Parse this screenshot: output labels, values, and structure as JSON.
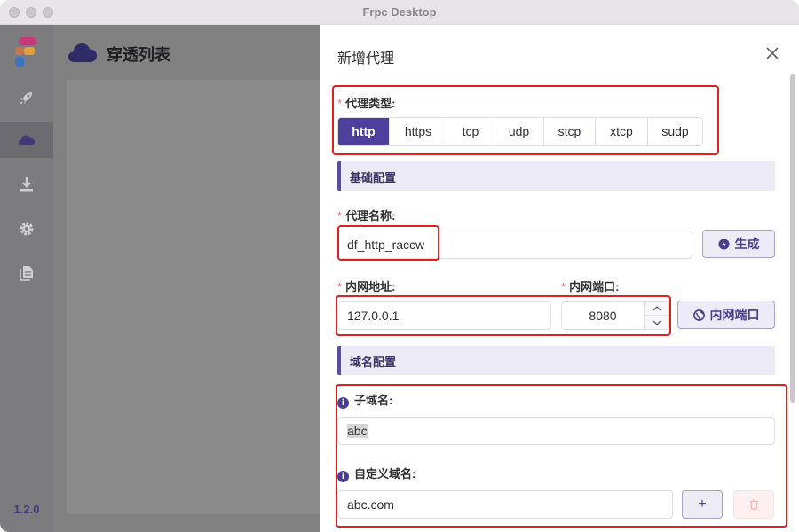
{
  "window": {
    "title": "Frpc Desktop"
  },
  "sidebar": {
    "items": [
      {
        "icon": "rocket-icon"
      },
      {
        "icon": "cloud-icon"
      },
      {
        "icon": "download-icon"
      },
      {
        "icon": "gear-icon"
      },
      {
        "icon": "file-icon"
      }
    ],
    "version": "1.2.0"
  },
  "main": {
    "title": "穿透列表"
  },
  "drawer": {
    "title": "新增代理",
    "proxy_type": {
      "label": "代理类型:",
      "options": [
        "http",
        "https",
        "tcp",
        "udp",
        "stcp",
        "xtcp",
        "sudp"
      ],
      "selected": "http"
    },
    "basic_section": "基础配置",
    "proxy_name": {
      "label": "代理名称:",
      "value": "df_http_raccw",
      "generate_label": "生成"
    },
    "local_ip": {
      "label": "内网地址:",
      "value": "127.0.0.1"
    },
    "local_port": {
      "label": "内网端口:",
      "value": "8080",
      "button_label": "内网端口"
    },
    "domain_section": "域名配置",
    "subdomain": {
      "label": "子域名:",
      "value": "abc"
    },
    "custom_domain": {
      "label": "自定义域名:",
      "value": "abc.com",
      "add_label": "+"
    }
  },
  "colors": {
    "accent": "#4e3f9c",
    "highlight": "#e02020",
    "required": "#f56c6c"
  }
}
